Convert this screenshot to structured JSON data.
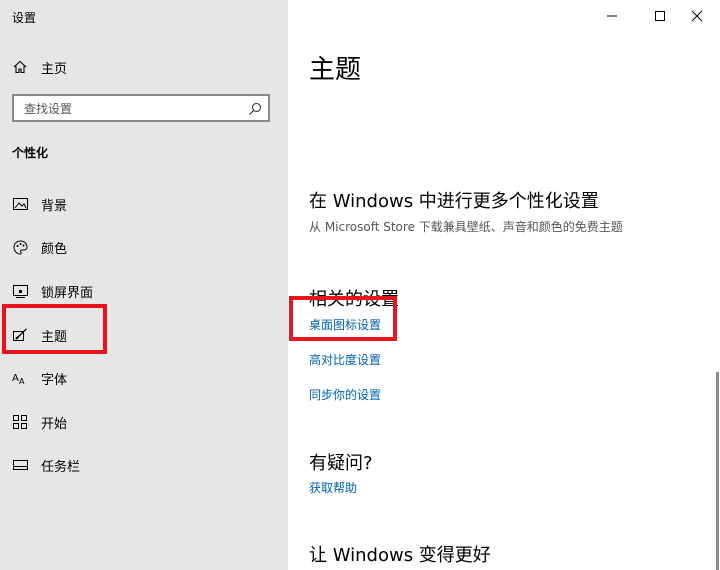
{
  "window": {
    "title": "设置"
  },
  "sidebar": {
    "home_label": "主页",
    "search_placeholder": "查找设置",
    "section_title": "个性化",
    "items": [
      {
        "label": "背景",
        "icon": "image-icon"
      },
      {
        "label": "颜色",
        "icon": "palette-icon"
      },
      {
        "label": "锁屏界面",
        "icon": "lock-screen-icon"
      },
      {
        "label": "主题",
        "icon": "theme-brush-icon"
      },
      {
        "label": "字体",
        "icon": "font-icon"
      },
      {
        "label": "开始",
        "icon": "start-grid-icon"
      },
      {
        "label": "任务栏",
        "icon": "taskbar-icon"
      }
    ]
  },
  "main": {
    "title": "主题",
    "more_personalize": {
      "heading": "在 Windows 中进行更多个性化设置",
      "subtext": "从 Microsoft Store 下载兼具壁纸、声音和颜色的免费主题"
    },
    "related": {
      "heading": "相关的设置",
      "links": [
        "桌面图标设置",
        "高对比度设置",
        "同步你的设置"
      ]
    },
    "questions": {
      "heading": "有疑问?",
      "link": "获取帮助"
    },
    "improve": {
      "heading": "让 Windows 变得更好"
    }
  },
  "colors": {
    "accent_link": "#0063b1",
    "highlight_box": "#e8141c",
    "sidebar_bg": "#e6e6e6"
  }
}
